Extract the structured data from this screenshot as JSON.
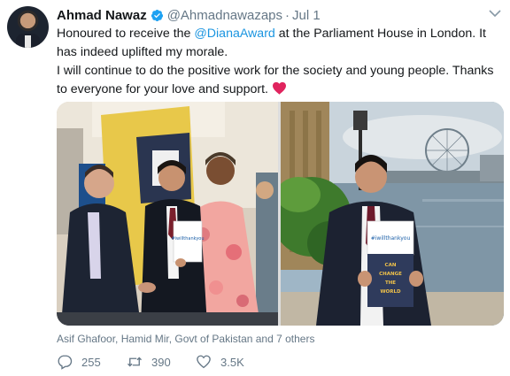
{
  "tweet": {
    "author_name": "Ahmad Nawaz",
    "handle": "@Ahmadnawazaps",
    "separator": "·",
    "date": "Jul 1",
    "text_line1_pre": "Honoured to receive the ",
    "mention": "@DianaAward",
    "text_line1_post": " at the Parliament House in London. It has indeed uplifted my morale.",
    "text_line2": "I will continue to do the positive work for the society and young people. Thanks to everyone for your love and support. ",
    "heart_emoji": "red-heart-icon",
    "tagged": "Asif Ghafoor, Hamid Mir, Govt of Pakistan and 7 others",
    "replies": "255",
    "retweets": "390",
    "likes": "3.5K",
    "accent_color": "#1b95e0",
    "heart_color": "#e0245e"
  },
  "photos": {
    "left_certificate_title": "#iwillthankyou",
    "right_book_lines": [
      "CAN",
      "CHANGE",
      "THE",
      "WORLD"
    ],
    "right_certificate_title": "#iwillthankyou"
  }
}
